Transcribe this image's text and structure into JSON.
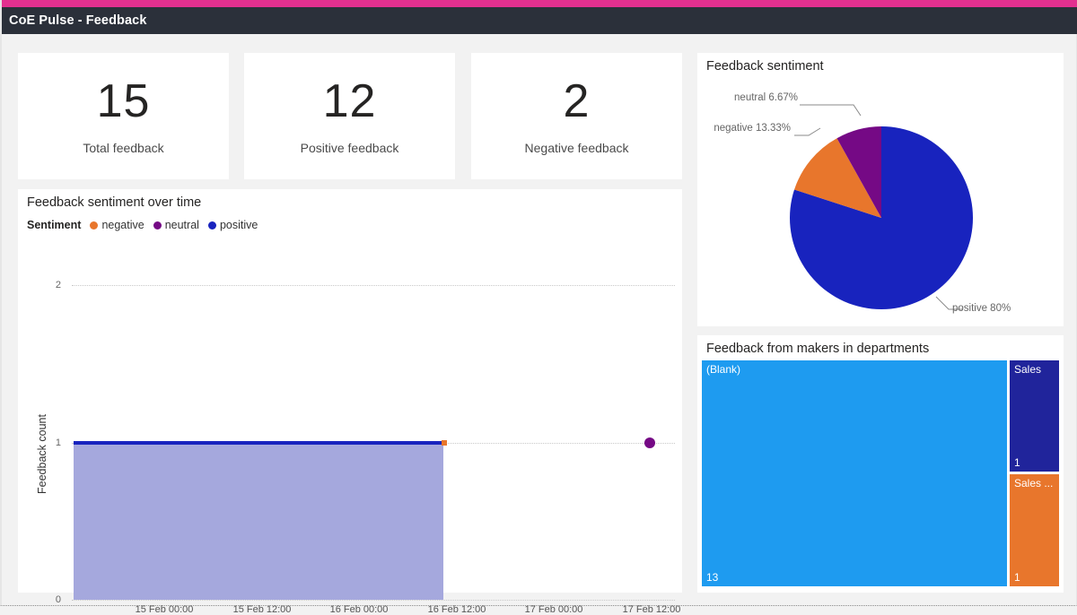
{
  "app": {
    "title": "CoE Pulse - Feedback",
    "accent_color": "#e3308f",
    "titlebar_color": "#2b303a",
    "background_color": "#f2f2f2"
  },
  "kpis": [
    {
      "value": "15",
      "label": "Total feedback"
    },
    {
      "value": "12",
      "label": "Positive feedback"
    },
    {
      "value": "2",
      "label": "Negative feedback"
    }
  ],
  "colors": {
    "negative": "#e8762c",
    "neutral": "#750985",
    "positive": "#1823be",
    "area_fill": "#a5a8dd",
    "treemap_blank": "#1e9bf0",
    "treemap_sales": "#20249b",
    "treemap_sales_other": "#e8762c"
  },
  "line_chart": {
    "title": "Feedback sentiment over time",
    "legend_title": "Sentiment",
    "legend": [
      {
        "label": "negative",
        "color": "#e8762c"
      },
      {
        "label": "neutral",
        "color": "#750985"
      },
      {
        "label": "positive",
        "color": "#1823be"
      }
    ]
  },
  "pie_chart": {
    "title": "Feedback sentiment"
  },
  "treemap": {
    "title": "Feedback from makers in departments"
  },
  "chart_data": [
    {
      "type": "area",
      "title": "Feedback sentiment over time",
      "xlabel": "",
      "ylabel": "Feedback count",
      "ylim": [
        0,
        2
      ],
      "yticks": [
        0,
        1,
        2
      ],
      "ytick_labels": [
        "0",
        "1",
        "2"
      ],
      "xtick_labels": [
        "15 Feb 00:00",
        "15 Feb 12:00",
        "16 Feb 00:00",
        "16 Feb 12:00",
        "17 Feb 00:00",
        "17 Feb 12:00"
      ],
      "grid": true,
      "legend_position": "top-left",
      "series": [
        {
          "name": "positive",
          "color": "#1823be",
          "x": [
            "14 Feb 18:00",
            "16 Feb 12:00"
          ],
          "values": [
            1,
            1
          ]
        },
        {
          "name": "negative",
          "color": "#e8762c",
          "x": [
            "16 Feb 12:00"
          ],
          "values": [
            1
          ]
        },
        {
          "name": "neutral",
          "color": "#750985",
          "x": [
            "17 Feb 12:00"
          ],
          "values": [
            1
          ]
        }
      ]
    },
    {
      "type": "pie",
      "title": "Feedback sentiment",
      "labels": [
        "positive",
        "negative",
        "neutral"
      ],
      "values": [
        80,
        13.33,
        6.67
      ],
      "value_suffix": "%",
      "colors": [
        "#1823be",
        "#e8762c",
        "#750985"
      ],
      "annotations": [
        "positive 80%",
        "negative 13.33%",
        "neutral 6.67%"
      ],
      "legend_position": "none"
    },
    {
      "type": "treemap",
      "title": "Feedback from makers in departments",
      "labels": [
        "(Blank)",
        "Sales",
        "Sales ..."
      ],
      "values": [
        13,
        1,
        1
      ],
      "colors": [
        "#1e9bf0",
        "#20249b",
        "#e8762c"
      ]
    }
  ],
  "pie_labels": {
    "neutral": "neutral 6.67%",
    "negative": "negative 13.33%",
    "positive": "positive 80%"
  },
  "treemap_tiles": [
    {
      "name": "(Blank)",
      "value": "13"
    },
    {
      "name": "Sales",
      "value": "1"
    },
    {
      "name": "Sales ...",
      "value": "1"
    }
  ],
  "axis": {
    "y_title": "Feedback count",
    "y_ticks": [
      "2",
      "1",
      "0"
    ],
    "x_ticks": [
      "15 Feb 00:00",
      "15 Feb 12:00",
      "16 Feb 00:00",
      "16 Feb 12:00",
      "17 Feb 00:00",
      "17 Feb 12:00"
    ]
  }
}
